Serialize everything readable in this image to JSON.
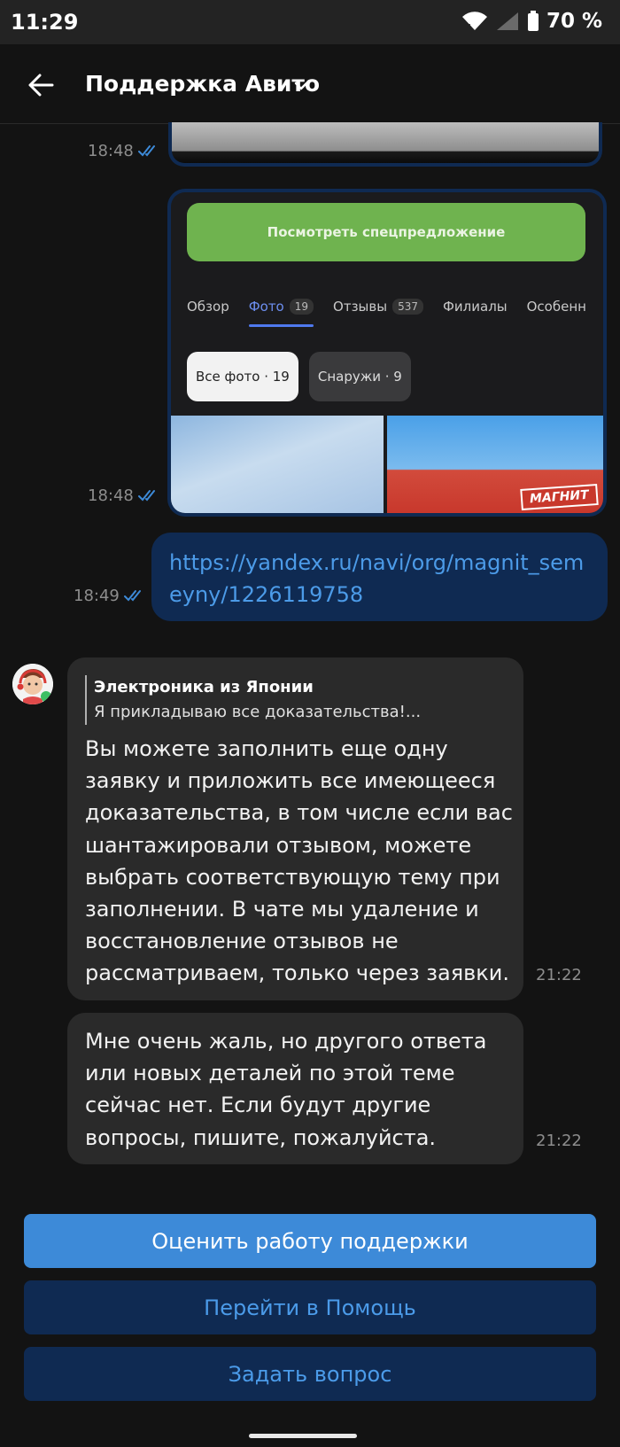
{
  "status_bar": {
    "time": "11:29",
    "battery": "70 %"
  },
  "header": {
    "title": "Поддержка Авито"
  },
  "messages": {
    "img1_time": "18:48",
    "img2_time": "18:48",
    "link_time": "18:49",
    "link_text": "https://yandex.ru/navi/org/magnit_semeyny/1226119758",
    "screenshot": {
      "promo_button": "Посмотреть спецпредложение",
      "tabs": [
        {
          "label": "Обзор"
        },
        {
          "label": "Фото",
          "count": "19"
        },
        {
          "label": "Отзывы",
          "count": "537"
        },
        {
          "label": "Филиалы"
        },
        {
          "label": "Особенн"
        }
      ],
      "chips": [
        "Все фото · 19",
        "Снаружи · 9"
      ],
      "store_sign": "МАГНИТ"
    },
    "reply_quote_author": "Электроника из Японии",
    "reply_quote_text": "Я прикладываю все доказательства!...",
    "reply_lines": [
      "Вы можете заполнить еще одну",
      "заявку и приложить все имеющееся",
      "доказательства, в том числе если вас",
      "шантажировали отзывом, можете",
      "выбрать соответствующую тему при",
      "заполнении. В чате мы удаление и",
      "восстановление отзывов не",
      "рассматриваем, только через заявки."
    ],
    "reply_time": "21:22",
    "second_lines": [
      "Мне очень жаль, но другого ответа",
      "или новых деталей по этой теме",
      "сейчас нет. Если будут другие",
      "вопросы, пишите, пожалуйста."
    ],
    "second_time": "21:22"
  },
  "actions": {
    "rate": "Оценить работу поддержки",
    "help": "Перейти в Помощь",
    "ask": "Задать вопрос"
  },
  "colors": {
    "accent": "#3d8ad8",
    "link": "#4c9be8",
    "outgoing": "#0f2a52",
    "incoming": "#2a2a2a"
  }
}
